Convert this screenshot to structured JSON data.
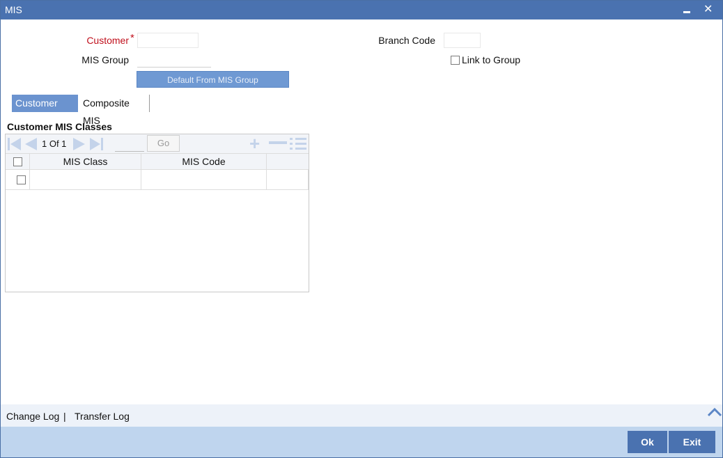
{
  "window": {
    "title": "MIS"
  },
  "form": {
    "customer_label": "Customer",
    "required_mark": "*",
    "customer_value": "",
    "mis_group_label": "MIS Group",
    "mis_group_value": "",
    "branch_code_label": "Branch Code",
    "branch_code_value": "",
    "link_to_group_label": "Link to Group",
    "default_button": "Default From MIS Group"
  },
  "tabs": [
    {
      "label": "Customer MIS",
      "active": true
    },
    {
      "label": "Composite MIS",
      "active": false
    }
  ],
  "grid": {
    "title": "Customer MIS Classes",
    "page_info": "1 Of 1",
    "go_label": "Go",
    "columns": [
      "MIS Class",
      "MIS Code"
    ],
    "rows": [
      {
        "mis_class": "",
        "mis_code": ""
      }
    ]
  },
  "footer": {
    "change_log": "Change Log",
    "separator": "|",
    "transfer_log": "Transfer Log",
    "ok_label": "Ok",
    "exit_label": "Exit"
  },
  "colors": {
    "titlebar": "#4a72b0",
    "accent": "#6b93cf",
    "required": "#c0101c",
    "bottombar": "#bfd5ee"
  }
}
